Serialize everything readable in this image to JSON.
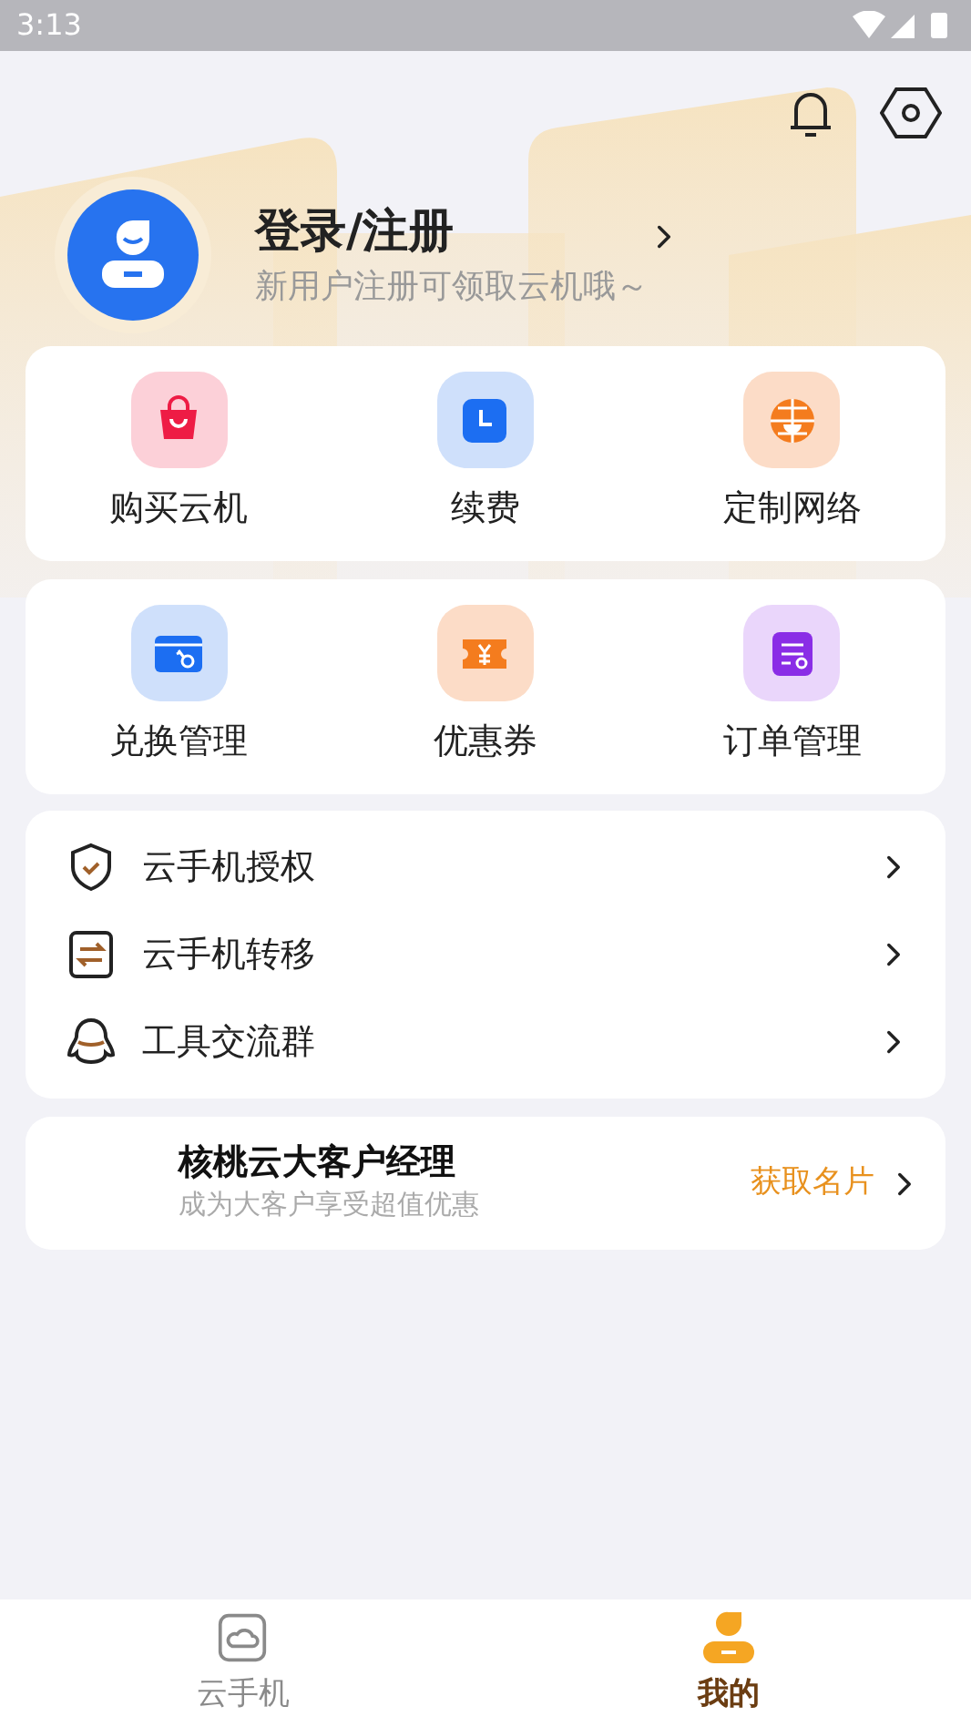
{
  "status_bar": {
    "time": "3:13"
  },
  "profile": {
    "title": "登录/注册",
    "subtitle": "新用户注册可领取云机哦～"
  },
  "grid_cards": [
    {
      "items": [
        {
          "kind": "bag",
          "label": "购买云机"
        },
        {
          "kind": "clock",
          "label": "续费"
        },
        {
          "kind": "globe",
          "label": "定制网络"
        }
      ]
    },
    {
      "items": [
        {
          "kind": "key",
          "label": "兑换管理"
        },
        {
          "kind": "coupon",
          "label": "优惠券"
        },
        {
          "kind": "order",
          "label": "订单管理"
        }
      ]
    }
  ],
  "menu": [
    {
      "kind": "shield",
      "label": "云手机授权"
    },
    {
      "kind": "transfer",
      "label": "云手机转移"
    },
    {
      "kind": "chat",
      "label": "工具交流群"
    }
  ],
  "manager": {
    "title": "核桃云大客户经理",
    "subtitle": "成为大客户享受超值优惠",
    "action": "获取名片"
  },
  "tab_bar": [
    {
      "kind": "cloud",
      "label": "云手机",
      "selected": false
    },
    {
      "kind": "me",
      "label": "我的",
      "selected": true
    }
  ]
}
